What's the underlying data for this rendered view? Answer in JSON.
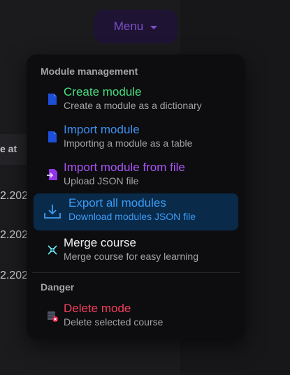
{
  "menu_button": {
    "label": "Menu"
  },
  "background": {
    "column_header": "e at",
    "rows": [
      "2.202",
      "2.202",
      "2.202"
    ]
  },
  "dropdown": {
    "sections": [
      {
        "title": "Module management",
        "items": [
          {
            "title": "Create module",
            "subtitle": "Create a module as a dictionary",
            "color": "#4ade80",
            "icon": "file-icon"
          },
          {
            "title": "Import module",
            "subtitle": "Importing a module as a table",
            "color": "#3b8ff0",
            "icon": "file-icon"
          },
          {
            "title": "Import module from file",
            "subtitle": "Upload JSON file",
            "color": "#a855f7",
            "icon": "file-import-icon"
          },
          {
            "title": "Export all modules",
            "subtitle": "Download modules JSON file",
            "color": "#3b9cf5",
            "icon": "download-icon",
            "active": true
          },
          {
            "title": "Merge course",
            "subtitle": "Merge course for easy learning",
            "color": "#f2f2f2",
            "icon": "merge-icon"
          }
        ]
      },
      {
        "title": "Danger",
        "items": [
          {
            "title": "Delete mode",
            "subtitle": "Delete selected course",
            "color": "#f43f5e",
            "icon": "delete-icon"
          }
        ]
      }
    ]
  }
}
